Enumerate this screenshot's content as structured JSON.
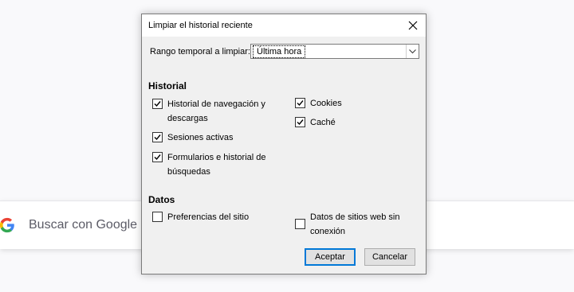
{
  "background": {
    "search_placeholder": "Buscar con Google"
  },
  "dialog": {
    "title": "Limpiar el historial reciente",
    "range_label": "Rango temporal a limpiar:",
    "range_value": "Última hora",
    "historial_title": "Historial",
    "datos_title": "Datos",
    "items": {
      "browsing": "Historial de navegación y descargas",
      "sessions": "Sesiones activas",
      "forms": "Formularios e historial de búsquedas",
      "cookies": "Cookies",
      "cache": "Caché",
      "site_prefs": "Preferencias del sitio",
      "offline": "Datos de sitios web sin conexión"
    },
    "checked": {
      "browsing": true,
      "sessions": true,
      "forms": true,
      "cookies": true,
      "cache": true,
      "site_prefs": false,
      "offline": false
    },
    "accept_label": "Aceptar",
    "cancel_label": "Cancelar"
  },
  "colors": {
    "dialog_bg": "#f0f0f0",
    "primary_border": "#0078d7"
  }
}
